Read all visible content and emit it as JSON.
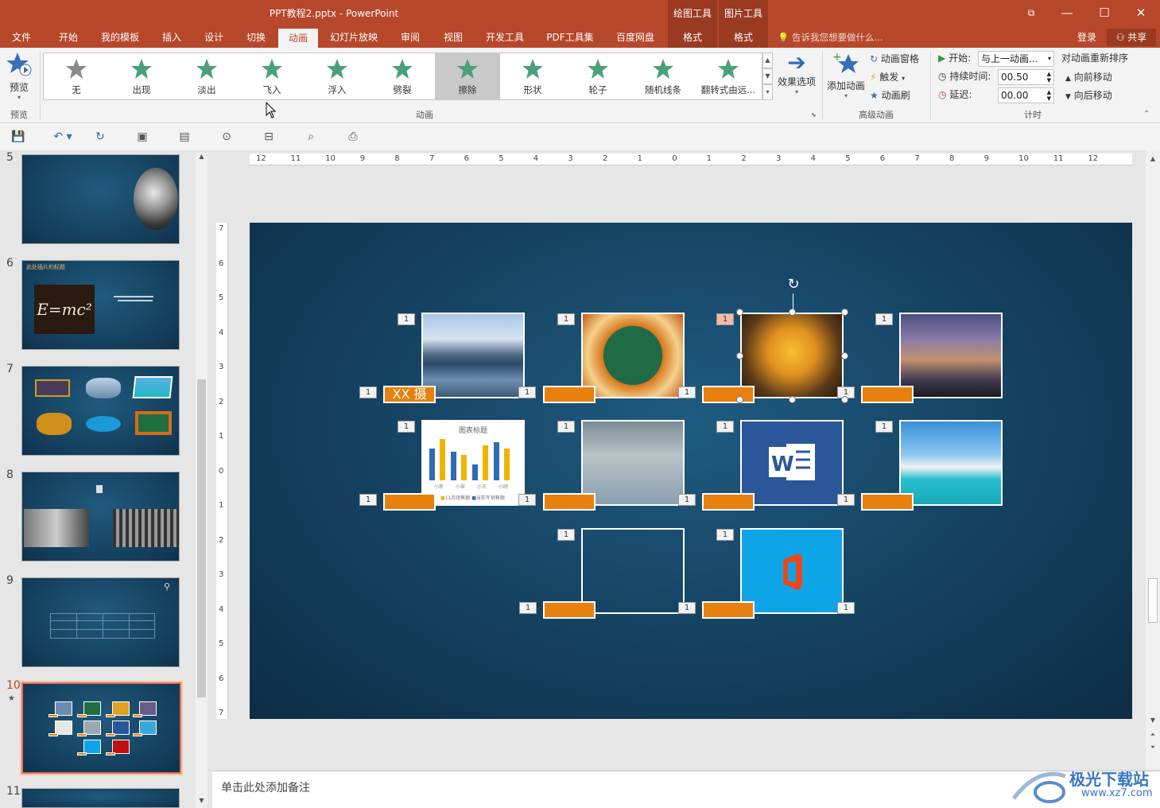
{
  "title": "PPT教程2.pptx - PowerPoint",
  "context_tools": [
    "绘图工具",
    "图片工具"
  ],
  "window": {
    "restore": "⧉",
    "minimize": "—",
    "maximize": "☐",
    "close": "✕"
  },
  "menu": [
    "文件",
    "开始",
    "我的模板",
    "插入",
    "设计",
    "切换",
    "动画",
    "幻灯片放映",
    "审阅",
    "视图",
    "开发工具",
    "PDF工具集",
    "百度网盘"
  ],
  "context_tabs": [
    "格式",
    "格式"
  ],
  "active_tab": "动画",
  "tell_me": "告诉我您想要做什么...",
  "login": "登录",
  "share": "共享",
  "preview": {
    "label": "预览",
    "group": "预览"
  },
  "animations": [
    "无",
    "出现",
    "淡出",
    "飞入",
    "浮入",
    "劈裂",
    "擦除",
    "形状",
    "轮子",
    "随机线条",
    "翻转式由远..."
  ],
  "selected_animation": "擦除",
  "group_animation": "动画",
  "effect_options": "效果选项",
  "advanced": {
    "add": "添加动画",
    "pane": "动画窗格",
    "trigger": "触发",
    "painter": "动画刷",
    "group": "高级动画"
  },
  "timing": {
    "start_label": "开始:",
    "start_value": "与上一动画...",
    "duration_label": "持续时间:",
    "duration_value": "00.50",
    "delay_label": "延迟:",
    "delay_value": "00.00",
    "group": "计时"
  },
  "reorder": {
    "title": "对动画重新排序",
    "earlier": "向前移动",
    "later": "向后移动"
  },
  "thumbnails": [
    {
      "num": "5"
    },
    {
      "num": "6",
      "title": "此处插片的标题",
      "formula": "E=mc²"
    },
    {
      "num": "7"
    },
    {
      "num": "8"
    },
    {
      "num": "9"
    },
    {
      "num": "10",
      "star": "★"
    },
    {
      "num": "11"
    }
  ],
  "ruler_h": [
    "12",
    "11",
    "10",
    "9",
    "8",
    "7",
    "6",
    "5",
    "4",
    "3",
    "2",
    "1",
    "0",
    "1",
    "2",
    "3",
    "4",
    "5",
    "6",
    "7",
    "8",
    "9",
    "10",
    "11",
    "12"
  ],
  "ruler_v": [
    "7",
    "6",
    "5",
    "4",
    "3",
    "2",
    "1",
    "0",
    "1",
    "2",
    "3",
    "4",
    "5",
    "6",
    "7"
  ],
  "slide": {
    "badge": "1",
    "caption_first": "XX 摄",
    "chart_title": "图表标题",
    "chart_legend": [
      "11月销售额",
      "当前年销售额"
    ],
    "chart_categories": [
      "小新",
      "小翠",
      "小王",
      "小刚"
    ],
    "chart_values": [
      50,
      65,
      45,
      40,
      25,
      55,
      60,
      50
    ]
  },
  "notes": "单击此处添加备注",
  "watermark": {
    "brand": "极光下载站",
    "url": "www.xz7.com"
  },
  "colors": {
    "accent": "#b7472a",
    "orange": "#e8800e",
    "slide_bg": "#14405f"
  }
}
